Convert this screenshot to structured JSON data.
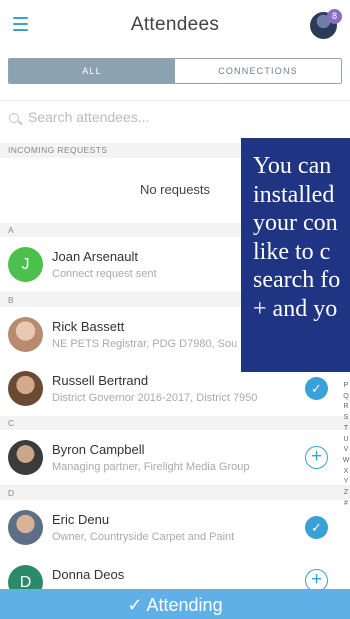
{
  "header": {
    "title": "Attendees",
    "badge_count": "8"
  },
  "tabs": {
    "all": "ALL",
    "connections": "CONNECTIONS"
  },
  "search": {
    "placeholder": "Search attendees..."
  },
  "incoming": {
    "header": "INCOMING REQUESTS",
    "empty": "No requests"
  },
  "sections": [
    {
      "letter": "A",
      "attendees": [
        {
          "name": "Joan Arsenault",
          "subtitle": "Connect request sent",
          "initial": "J",
          "avatar_color": "#4cc04c",
          "action": "none"
        }
      ]
    },
    {
      "letter": "B",
      "attendees": [
        {
          "name": "Rick Bassett",
          "subtitle": "NE PETS Registrar, PDG D7980, Sou",
          "action": "none"
        },
        {
          "name": "Russell Bertrand",
          "subtitle": "District Governor 2016-2017, District 7950",
          "action": "connected"
        }
      ]
    },
    {
      "letter": "C",
      "attendees": [
        {
          "name": "Byron Campbell",
          "subtitle": "Managing partner, Firelight Media Group",
          "action": "add"
        }
      ]
    },
    {
      "letter": "D",
      "attendees": [
        {
          "name": "Eric Denu",
          "subtitle": "Owner, Countryside Carpet and Paint",
          "action": "connected"
        },
        {
          "name": "Donna Deos",
          "subtitle": "",
          "initial": "D",
          "avatar_color": "#2a8a6a",
          "action": "add"
        }
      ]
    }
  ],
  "alpha_index": [
    "P",
    "Q",
    "R",
    "S",
    "T",
    "U",
    "V",
    "W",
    "X",
    "Y",
    "Z",
    "#"
  ],
  "overlay_text": [
    "You can",
    "installed",
    "your con",
    "like to c",
    "search fo",
    "+ and yo"
  ],
  "bottom_bar": {
    "label": "Attending",
    "icon": "check-icon"
  },
  "colors": {
    "accent": "#3aa0d8",
    "tab_active": "#8da2b0",
    "overlay": "#1f3583",
    "bottom_bar": "#5fb0e6"
  }
}
